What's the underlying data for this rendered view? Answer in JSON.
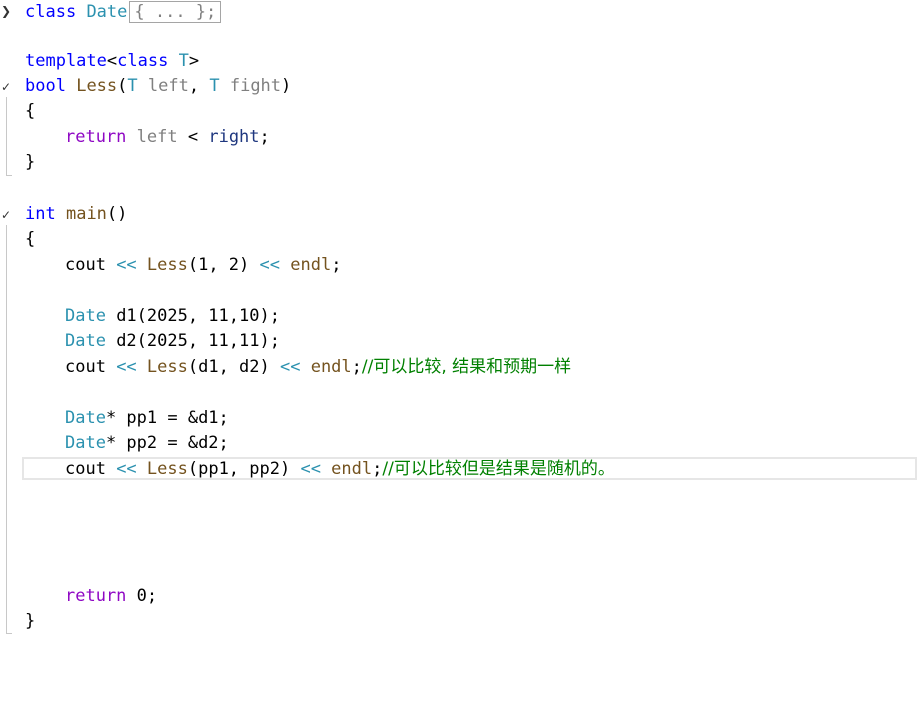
{
  "code": {
    "l1_kw": "class",
    "l1_type": "Date",
    "l1_collapsed": "{ ... };",
    "l3_kw": "template",
    "l3_lt": "<",
    "l3_kw2": "class",
    "l3_sp": " ",
    "l3_t": "T",
    "l3_gt": ">",
    "l4_kw": "bool",
    "l4_fn": "Less",
    "l4_open": "(",
    "l4_t1": "T",
    "l4_p1": "left",
    "l4_comma": ", ",
    "l4_t2": "T",
    "l4_p2": "fight",
    "l4_close": ")",
    "brace_open": "{",
    "brace_close": "}",
    "l6_ret": "return",
    "l6_left": "left",
    "l6_op": " < ",
    "l6_right": "right",
    "l6_semi": ";",
    "l9_kw": "int",
    "l9_fn": "main",
    "l9_parens": "()",
    "l11_cout": "cout",
    "l11_op1": " << ",
    "l11_fn": "Less",
    "l11_args": "(1, 2)",
    "l11_op2": " << ",
    "l11_endl": "endl",
    "l11_semi": ";",
    "l13_type": "Date",
    "l13_rest": " d1(2025, 11,10);",
    "l14_type": "Date",
    "l14_rest": " d2(2025, 11,11);",
    "l15_cout": "cout",
    "l15_op1": " << ",
    "l15_fn": "Less",
    "l15_args": "(d1, d2)",
    "l15_op2": " << ",
    "l15_endl": "endl",
    "l15_semi": ";",
    "l15_cmt": "//可以比较, 结果和预期一样",
    "l17_type": "Date",
    "l17_rest": "* pp1 = &d1;",
    "l18_type": "Date",
    "l18_rest": "* pp2 = &d2;",
    "l19_cout": "cout",
    "l19_op1": " << ",
    "l19_fn": "Less",
    "l19_args": "(pp1, pp2)",
    "l19_op2": " << ",
    "l19_endl": "endl",
    "l19_semi": ";",
    "l19_cmt": "//可以比较但是结果是随机的。",
    "l24_ret": "return",
    "l24_rest": " 0;"
  },
  "colors": {
    "keyword": "#0000ff",
    "control_keyword": "#8f08c4",
    "type": "#2b91af",
    "function": "#74531f",
    "parameter": "#808080",
    "comment": "#008000"
  },
  "icons": {
    "collapsed_fold": "chevron-right-icon",
    "expanded_fold": "chevron-down-icon"
  }
}
